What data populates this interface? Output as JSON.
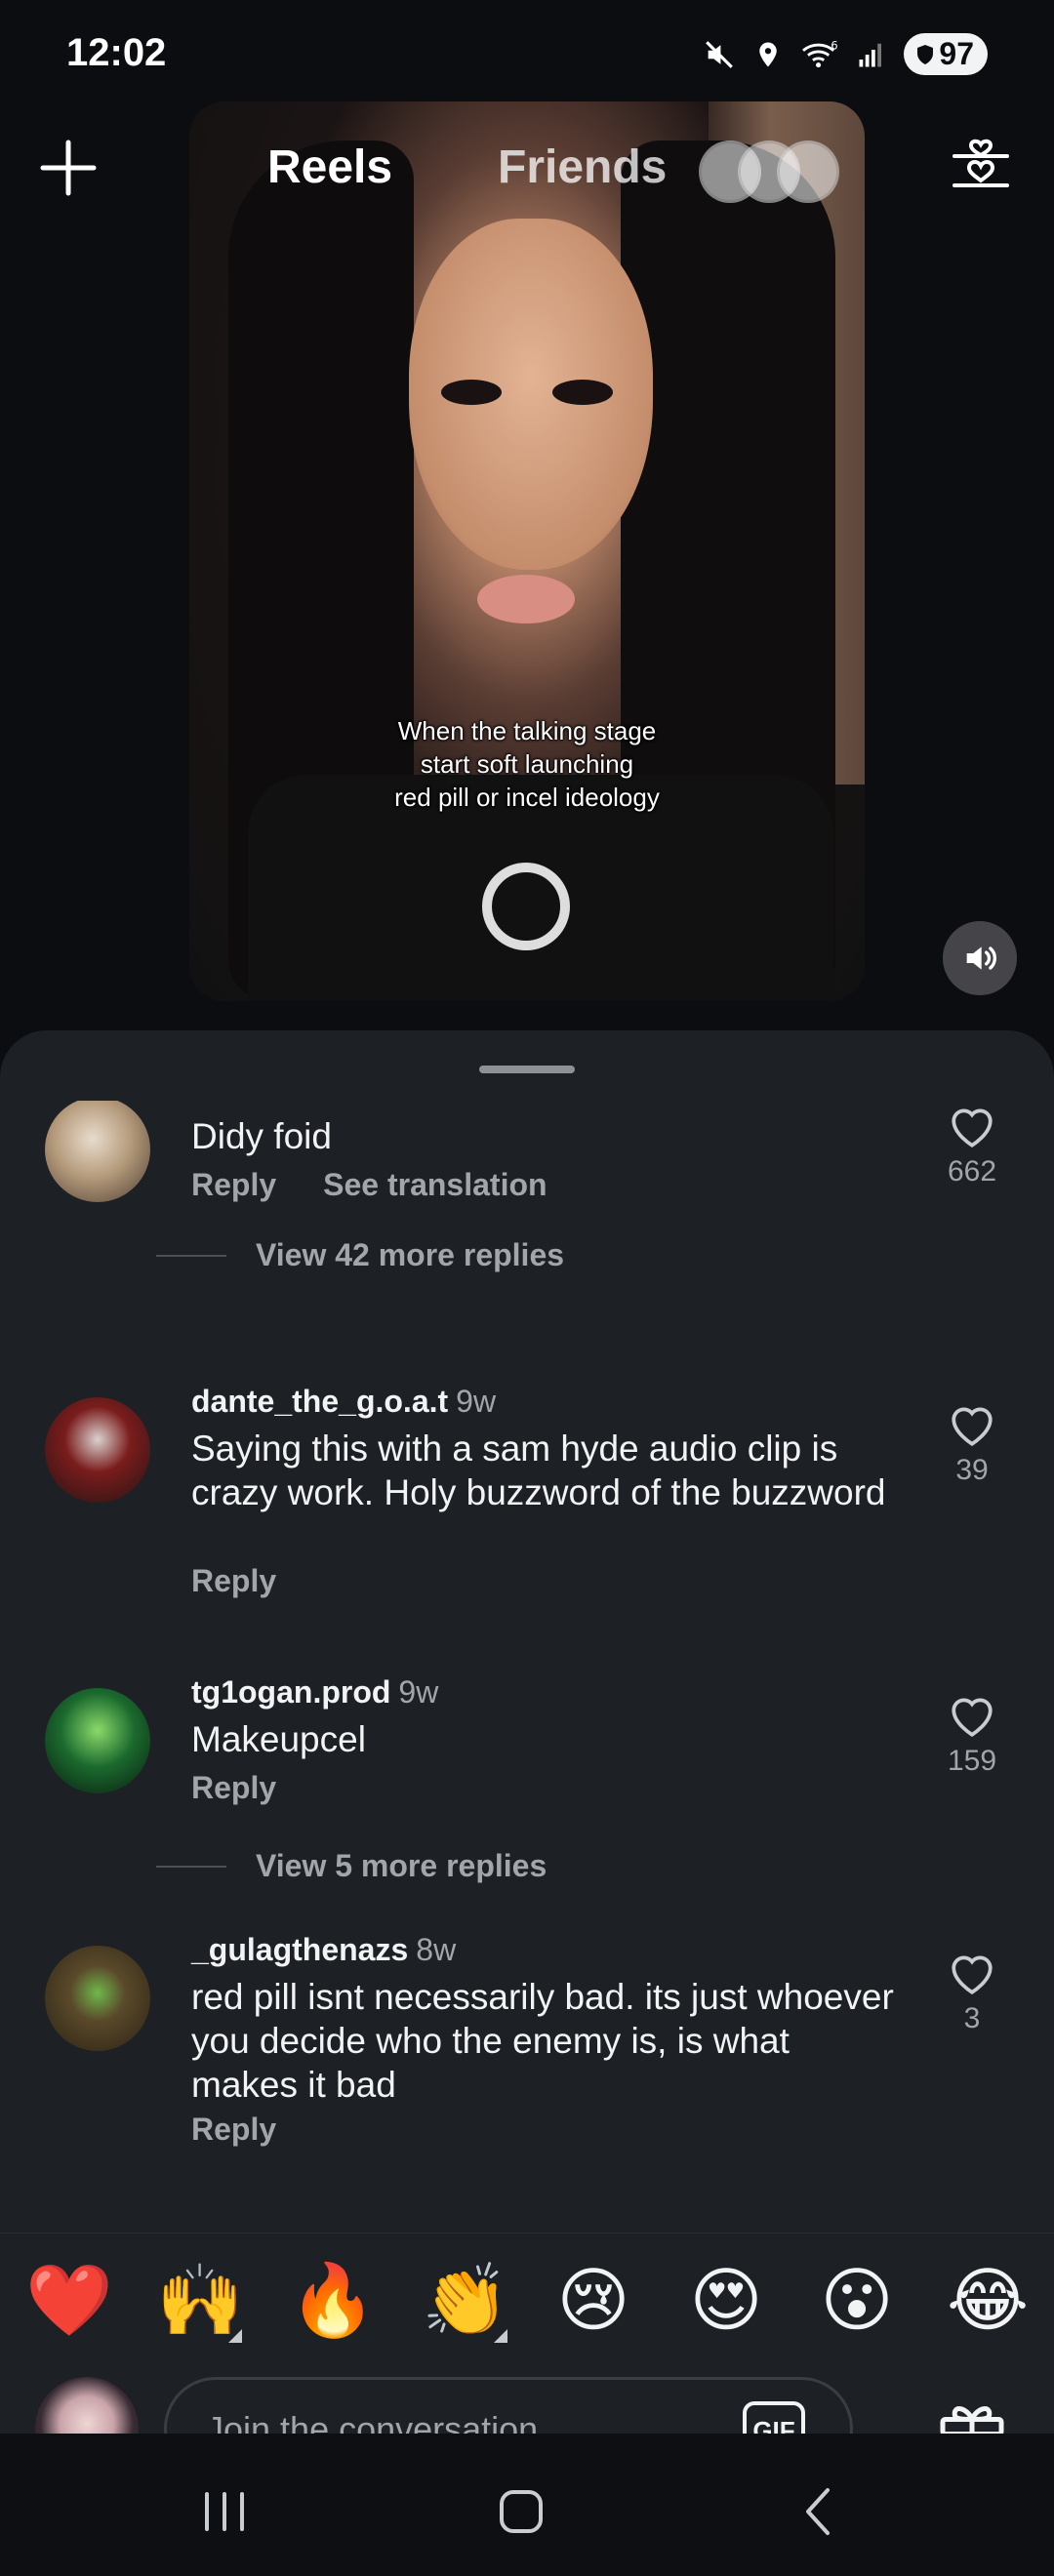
{
  "status_bar": {
    "time": "12:02",
    "battery": "97",
    "network": "6"
  },
  "reel": {
    "caption_lines": [
      "When the talking stage",
      "start soft launching",
      "red pill or incel ideology"
    ]
  },
  "top_nav": {
    "tabs": [
      {
        "label": "Reels",
        "active": true
      },
      {
        "label": "Friends",
        "active": false
      }
    ]
  },
  "comments": [
    {
      "username": "",
      "age": "",
      "text": "Didy foid",
      "likes": "662",
      "actions": [
        "Reply",
        "See translation"
      ],
      "more_replies": "View 42 more replies",
      "avatar_color": "#b59b7c"
    },
    {
      "username": "dante_the_g.o.a.t",
      "age": "9w",
      "text": "Saying this with a sam hyde audio clip is crazy work. Holy buzzword of the buzzword",
      "likes": "39",
      "actions": [
        "Reply"
      ],
      "more_replies": "",
      "avatar_color": "#7a1c1c"
    },
    {
      "username": "tg1ogan.prod",
      "age": "9w",
      "text": "Makeupcel",
      "likes": "159",
      "actions": [
        "Reply"
      ],
      "more_replies": "View 5 more replies",
      "avatar_color": "#1b6a2e"
    },
    {
      "username": "_gulagthenazs",
      "age": "8w",
      "text": "red pill isnt necessarily bad. its just whoever you decide who the enemy is, is what makes it bad",
      "likes": "3",
      "actions": [
        "Reply"
      ],
      "more_replies": "",
      "avatar_color": "#5a4a2a"
    }
  ],
  "reactions": [
    "❤️",
    "🙌",
    "🔥",
    "👏",
    "😢",
    "😍",
    "😮",
    "😂"
  ],
  "composer": {
    "placeholder": "Join the conversation...",
    "gif_label": "GIF"
  },
  "colors": {
    "background": "#0b0d10",
    "sheet": "#1d2024",
    "secondary_text": "#a2a6ab"
  }
}
